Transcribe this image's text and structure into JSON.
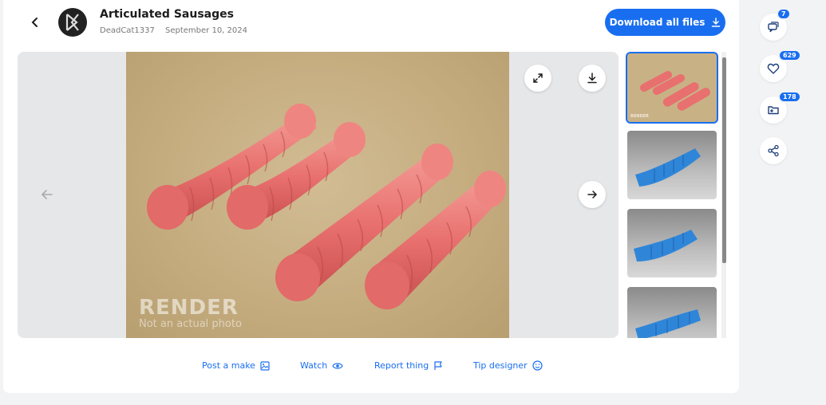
{
  "header": {
    "title": "Articulated Sausages",
    "author": "DeadCat1337",
    "date": "September 10, 2024",
    "download_all_label": "Download all files"
  },
  "viewer": {
    "watermark_title": "RENDER",
    "watermark_subtitle": "Not an actual photo",
    "thumbnail_watermark": "RENDER"
  },
  "actions": {
    "post_make": "Post a make",
    "watch": "Watch",
    "report": "Report thing",
    "tip": "Tip designer"
  },
  "sidebar": {
    "comments_count": "7",
    "likes_count": "629",
    "collections_count": "178"
  },
  "colors": {
    "accent": "#196ef0",
    "sausage_pink": "#e8706e",
    "thumb_blue": "#2f86d8"
  }
}
